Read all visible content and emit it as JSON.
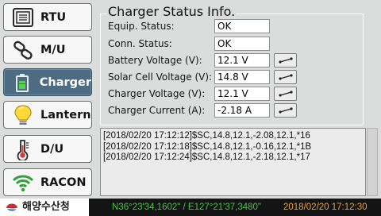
{
  "sidebar": {
    "items": [
      {
        "label": "RTU",
        "icon": "rtu-icon",
        "active": false
      },
      {
        "label": "M/U",
        "icon": "link-icon",
        "active": false
      },
      {
        "label": "Charger",
        "icon": "battery-icon",
        "active": true
      },
      {
        "label": "Lantern",
        "icon": "lightbulb-icon",
        "active": false
      },
      {
        "label": "D/U",
        "icon": "thermometer-icon",
        "active": false
      },
      {
        "label": "RACON",
        "icon": "wifi-icon",
        "active": false
      }
    ]
  },
  "panel": {
    "title": "Charger Status Info.",
    "rows": [
      {
        "label": "Equip. Status:",
        "value": "OK"
      },
      {
        "label": "Conn. Status:",
        "value": "OK"
      },
      {
        "label": "Battery Voltage (V):",
        "value": "12.1 V"
      },
      {
        "label": "Solar Cell Voltage (V):",
        "value": "14.8 V"
      },
      {
        "label": "Charger Voltage (V):",
        "value": "12.1 V"
      },
      {
        "label": "Charger Current (A):",
        "value": "-2.18 A"
      }
    ]
  },
  "log": {
    "lines": [
      "[2018/02/20 17:12:12]$SC,14.8,12.1,-2.08,12.1,*16",
      "[2018/02/20 17:12:18]$SC,14.8,12.1,-0.16,12.1,*1B",
      "[2018/02/20 17:12:24]$SC,14.8,12.1,-2.18,12.1,*17"
    ]
  },
  "footer": {
    "logo_text": "해양수산청",
    "gps": "N36°23'34,1602\" / E127°21'37,3480\"",
    "clock": "2018/02/20 17:12:30"
  },
  "colors": {
    "background": "#dbdcdc",
    "active_button": "#4d6c83",
    "gps_text": "#46c34a",
    "clock_text": "#e9a13a",
    "status_bar": "#141414"
  }
}
